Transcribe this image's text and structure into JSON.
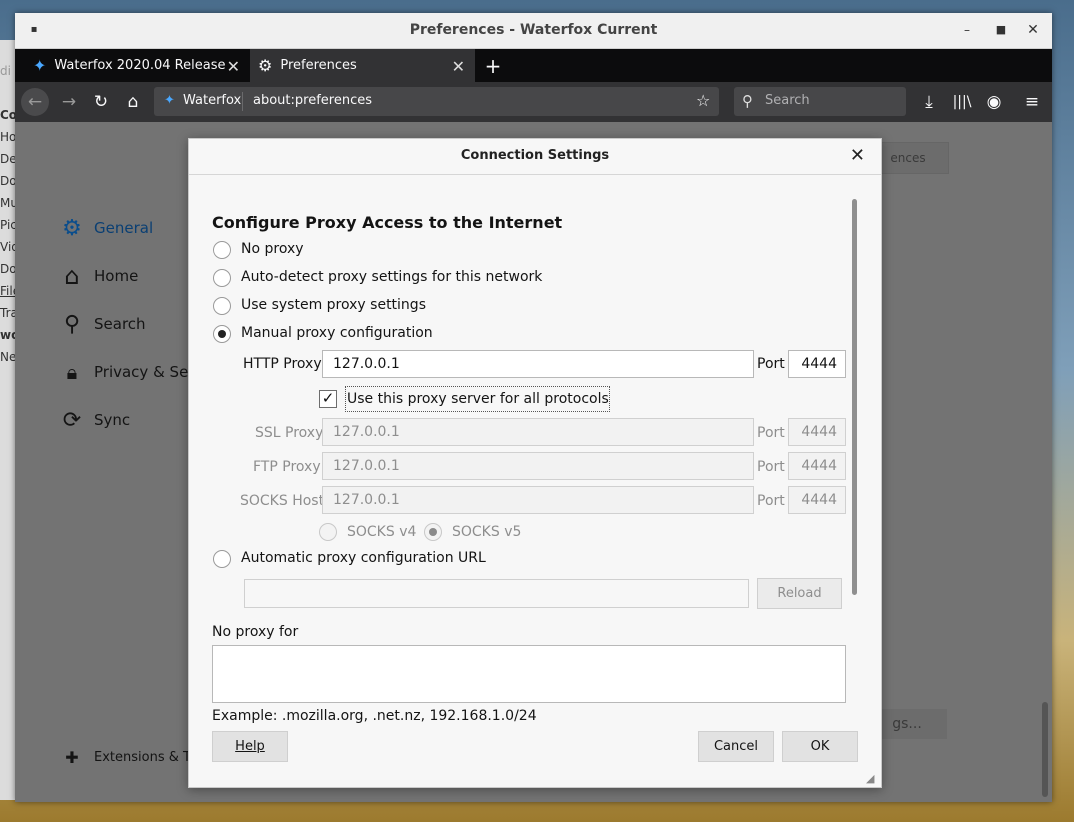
{
  "window": {
    "title": "Preferences - Waterfox Current"
  },
  "tabs": [
    {
      "label": "Waterfox 2020.04 Release"
    },
    {
      "label": "Preferences"
    }
  ],
  "nav": {
    "identity_label": "Waterfox",
    "url": "about:preferences",
    "search_placeholder": "Search"
  },
  "sidebar": {
    "items": [
      {
        "label": "General"
      },
      {
        "label": "Home"
      },
      {
        "label": "Search"
      },
      {
        "label": "Privacy & Sec"
      },
      {
        "label": "Sync"
      }
    ],
    "extensions_label": "Extensions & Th"
  },
  "background": {
    "left_fragments": [
      "di",
      "Co",
      "Ho",
      "De",
      "Do",
      "Mu",
      "Pic",
      "Vid",
      "Do",
      "File",
      "Tra",
      "wo",
      "Ne"
    ],
    "top_right_button": "ences",
    "bottom_right_button": "gs..."
  },
  "dialog": {
    "title": "Connection Settings",
    "heading": "Configure Proxy Access to the Internet",
    "options": {
      "no_proxy": "No proxy",
      "auto_detect": "Auto-detect proxy settings for this network",
      "system": "Use system proxy settings",
      "manual": "Manual proxy configuration",
      "auto_url": "Automatic proxy configuration URL"
    },
    "http": {
      "label": "HTTP Proxy",
      "value": "127.0.0.1",
      "port_label": "Port",
      "port": "4444"
    },
    "use_all_protocols": "Use this proxy server for all protocols",
    "ssl": {
      "label": "SSL Proxy",
      "value": "127.0.0.1",
      "port_label": "Port",
      "port": "4444"
    },
    "ftp": {
      "label": "FTP Proxy",
      "value": "127.0.0.1",
      "port_label": "Port",
      "port": "4444"
    },
    "socks": {
      "label": "SOCKS Host",
      "value": "127.0.0.1",
      "port_label": "Port",
      "port": "4444"
    },
    "socks_v4": "SOCKS v4",
    "socks_v5": "SOCKS v5",
    "reload": "Reload",
    "no_proxy_for_label": "No proxy for",
    "no_proxy_for_value": "",
    "example": "Example: .mozilla.org, .net.nz, 192.168.1.0/24",
    "help": "Help",
    "cancel": "Cancel",
    "ok": "OK"
  }
}
